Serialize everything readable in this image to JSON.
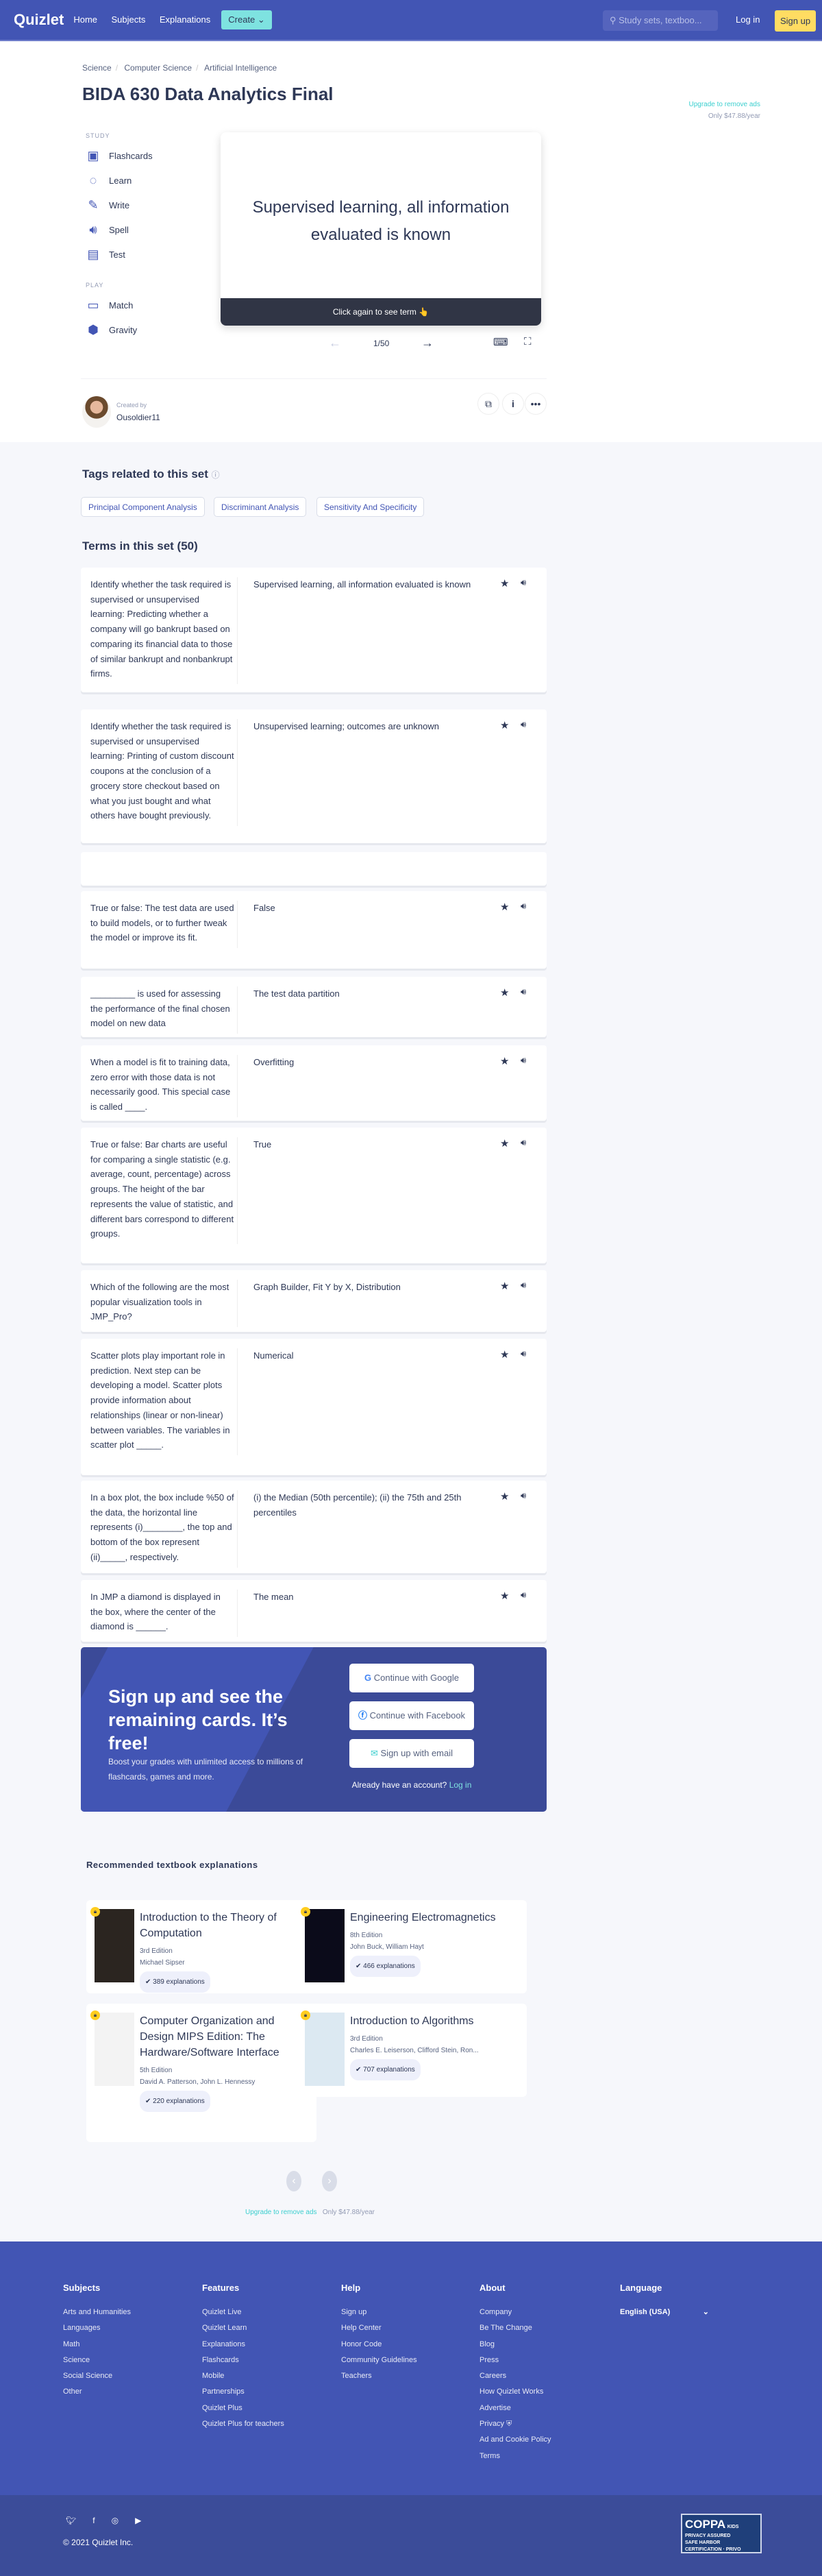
{
  "header": {
    "logo": "Quizlet",
    "nav": [
      "Home",
      "Subjects",
      "Explanations"
    ],
    "create": "Create",
    "search_placeholder": "Study sets, textboo...",
    "login": "Log in",
    "signup": "Sign up"
  },
  "breadcrumb": [
    "Science",
    "Computer Science",
    "Artificial Intelligence"
  ],
  "title": "BIDA 630 Data Analytics Final",
  "ad": {
    "upgrade": "Upgrade to remove ads",
    "price": "Only $47.88/year"
  },
  "study": {
    "label": "STUDY",
    "items": [
      "Flashcards",
      "Learn",
      "Write",
      "Spell",
      "Test"
    ],
    "play_label": "PLAY",
    "play_items": [
      "Match",
      "Gravity"
    ]
  },
  "flashcard": {
    "text": "Supervised learning, all information evaluated is known",
    "footer": "Click again to see term 👆",
    "counter": "1/50"
  },
  "creator": {
    "label": "Created by",
    "name": "Ousoldier11"
  },
  "tags": {
    "heading": "Tags related to this set",
    "items": [
      "Principal Component Analysis",
      "Discriminant Analysis",
      "Sensitivity And Specificity"
    ]
  },
  "terms_heading": "Terms in this set (50)",
  "terms": [
    {
      "term": "Identify whether the task required is supervised or unsupervised learning: Predicting whether a company will go bankrupt based on comparing its financial data to those of similar bankrupt and nonbankrupt firms.",
      "def": "Supervised learning, all information evaluated is known"
    },
    {
      "term": "Identify whether the task required is supervised or unsupervised learning: Printing of custom discount coupons at the conclusion of a grocery store checkout based on what you just bought and what others have bought previously.",
      "def": "Unsupervised learning; outcomes are unknown"
    },
    {
      "term": "",
      "def": ""
    },
    {
      "term": "True or false: The test data are used to build models, or to further tweak the model or improve its fit.",
      "def": "False"
    },
    {
      "term": "_________ is used for assessing the performance of the final chosen model on new data",
      "def": "The test data partition"
    },
    {
      "term": "When a model is fit to training data, zero error with those data is not necessarily good. This special case is called ____.",
      "def": "Overfitting"
    },
    {
      "term": "True or false: Bar charts are useful for comparing a single statistic (e.g. average, count, percentage) across groups. The height of the bar represents the value of statistic, and different bars correspond to different groups.",
      "def": "True"
    },
    {
      "term": "Which of the following are the most popular visualization tools in JMP_Pro?",
      "def": "Graph Builder, Fit Y by X, Distribution"
    },
    {
      "term": "Scatter plots play important role in prediction. Next step can be developing a model. Scatter plots provide information about relationships (linear or non-linear) between variables. The variables in scatter plot _____.",
      "def": "Numerical"
    },
    {
      "term": "In a box plot, the box include %50 of the data, the horizontal line represents (i)________, the top and bottom of the box represent (ii)_____, respectively.",
      "def": "(i) the Median (50th percentile); (ii) the 75th and 25th percentiles"
    },
    {
      "term": "In JMP a diamond is displayed in the box, where the center of the diamond is ______.",
      "def": "The mean"
    }
  ],
  "promo": {
    "heading": "Sign up and see the remaining cards. It’s free!",
    "text": "Boost your grades with unlimited access to millions of flashcards, games and more.",
    "google": "Continue with Google",
    "facebook": "Continue with Facebook",
    "email": "Sign up with email",
    "have_account": "Already have an account?",
    "login": "Log in"
  },
  "textbooks": {
    "heading": "Recommended textbook explanations",
    "items": [
      {
        "title": "Introduction to the Theory of Computation",
        "edition": "3rd Edition",
        "authors": "Michael Sipser",
        "count": "389 explanations"
      },
      {
        "title": "Engineering Electromagnetics",
        "edition": "8th Edition",
        "authors": "John Buck, William Hayt",
        "count": "466 explanations"
      },
      {
        "title": "Computer Organization and Design MIPS Edition: The Hardware/Software Interface",
        "edition": "5th Edition",
        "authors": "David A. Patterson, John L. Hennessy",
        "count": "220 explanations"
      },
      {
        "title": "Introduction to Algorithms",
        "edition": "3rd Edition",
        "authors": "Charles E. Leiserson, Clifford Stein, Ron...",
        "count": "707 explanations"
      }
    ]
  },
  "footer": {
    "columns": [
      {
        "heading": "Subjects",
        "links": [
          "Arts and Humanities",
          "Languages",
          "Math",
          "Science",
          "Social Science",
          "Other"
        ]
      },
      {
        "heading": "Features",
        "links": [
          "Quizlet Live",
          "Quizlet Learn",
          "Explanations",
          "Flashcards",
          "Mobile",
          "Partnerships",
          "Quizlet Plus",
          "Quizlet Plus for teachers"
        ]
      },
      {
        "heading": "Help",
        "links": [
          "Sign up",
          "Help Center",
          "Honor Code",
          "Community Guidelines",
          "Teachers"
        ]
      },
      {
        "heading": "About",
        "links": [
          "Company",
          "Be The Change",
          "Blog",
          "Press",
          "Careers",
          "How Quizlet Works",
          "Advertise",
          "Privacy",
          "Ad and Cookie Policy",
          "Terms"
        ]
      }
    ],
    "language_heading": "Language",
    "language": "English (USA)",
    "copyright": "© 2021 Quizlet Inc.",
    "badge": "COPPA KIDS PRIVACY ASSURED SAFE HARBOR CERTIFICATION PRIVO"
  },
  "colors": {
    "brand": "#4255b4",
    "accent": "#7ee2e0",
    "signup": "#ffdc62",
    "dark": "#2e3856"
  }
}
